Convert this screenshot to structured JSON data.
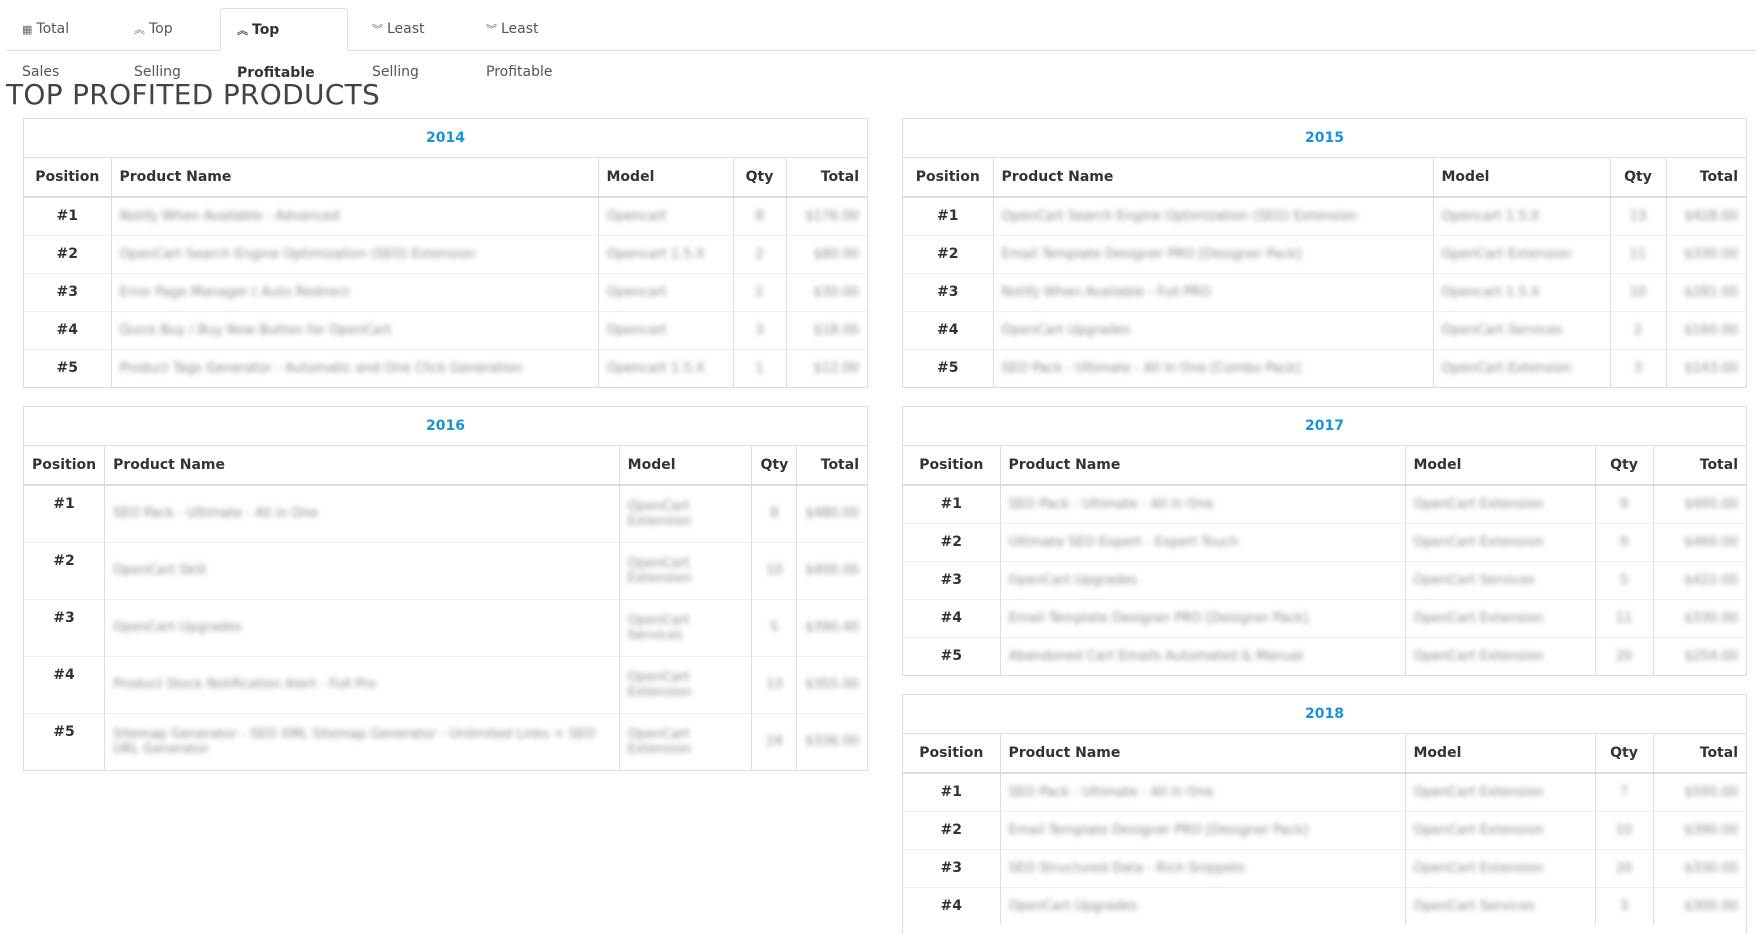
{
  "tabs": [
    {
      "label": "Total Sales",
      "icon": "table-icon",
      "active": false
    },
    {
      "label": "Top Selling",
      "icon": "chevron-double-up-icon",
      "active": false
    },
    {
      "label": "Top Profitable",
      "icon": "chevron-double-up-icon",
      "active": true
    },
    {
      "label": "Least Selling",
      "icon": "chevron-double-down-icon",
      "active": false
    },
    {
      "label": "Least Profitable",
      "icon": "chevron-double-down-icon",
      "active": false
    }
  ],
  "page_title": "TOP PROFITED PRODUCTS",
  "colors": {
    "year_heading": "#1e91cf"
  },
  "columns": {
    "position": "Position",
    "name": "Product Name",
    "model": "Model",
    "qty": "Qty",
    "total": "Total"
  },
  "panels": [
    {
      "year": "2014",
      "rows": [
        {
          "pos": "#1",
          "name": "Notify When Available - Advanced",
          "model": "Opencart",
          "qty": "8",
          "total": "$176.00"
        },
        {
          "pos": "#2",
          "name": "OpenCart Search Engine Optimization (SEO) Extension",
          "model": "Opencart 1.5.X",
          "qty": "2",
          "total": "$80.00"
        },
        {
          "pos": "#3",
          "name": "Error Page Manager ( Auto Redirect",
          "model": "Opencart",
          "qty": "2",
          "total": "$30.00"
        },
        {
          "pos": "#4",
          "name": "Quick Buy / Buy Now Button for OpenCart",
          "model": "Opencart",
          "qty": "3",
          "total": "$18.00"
        },
        {
          "pos": "#5",
          "name": "Product Tags Generator - Automatic and One Click Generation",
          "model": "Opencart 1.5.X",
          "qty": "1",
          "total": "$12.00"
        }
      ]
    },
    {
      "year": "2015",
      "rows": [
        {
          "pos": "#1",
          "name": "OpenCart Search Engine Optimization (SEO) Extension",
          "model": "Opencart 1.5.X",
          "qty": "13",
          "total": "$428.00"
        },
        {
          "pos": "#2",
          "name": "Email Template Designer PRO [Designer Pack]",
          "model": "OpenCart Extension",
          "qty": "11",
          "total": "$330.00"
        },
        {
          "pos": "#3",
          "name": "Notify When Available - Full PRO",
          "model": "Opencart 1.5.X",
          "qty": "10",
          "total": "$281.00"
        },
        {
          "pos": "#4",
          "name": "OpenCart Upgrades",
          "model": "OpenCart Services",
          "qty": "2",
          "total": "$160.00"
        },
        {
          "pos": "#5",
          "name": "SEO Pack - Ultimate - All in One [Combo Pack]",
          "model": "OpenCart Extension",
          "qty": "3",
          "total": "$143.00"
        }
      ]
    },
    {
      "year": "2016",
      "rows": [
        {
          "pos": "#1",
          "name": "SEO Pack - Ultimate - All in One",
          "model": "OpenCart Extension",
          "qty": "8",
          "total": "$480.00"
        },
        {
          "pos": "#2",
          "name": "OpenCart Skill",
          "model": "OpenCart Extension",
          "qty": "10",
          "total": "$400.00"
        },
        {
          "pos": "#3",
          "name": "OpenCart Upgrades",
          "model": "OpenCart Services",
          "qty": "5",
          "total": "$390.40"
        },
        {
          "pos": "#4",
          "name": "Product Stock Notification Alert - Full Pro",
          "model": "OpenCart Extension",
          "qty": "13",
          "total": "$355.00"
        },
        {
          "pos": "#5",
          "name": "Sitemap Generator - SEO XML Sitemap Generator - Unlimited Links + SEO URL Generator",
          "model": "OpenCart Extension",
          "qty": "24",
          "total": "$336.00"
        }
      ]
    },
    {
      "year": "2017",
      "rows": [
        {
          "pos": "#1",
          "name": "SEO Pack - Ultimate - All in One",
          "model": "OpenCart Extension",
          "qty": "9",
          "total": "$495.00"
        },
        {
          "pos": "#2",
          "name": "Ultimate SEO Expert - Expert Touch",
          "model": "OpenCart Extension",
          "qty": "9",
          "total": "$460.00"
        },
        {
          "pos": "#3",
          "name": "OpenCart Upgrades",
          "model": "OpenCart Services",
          "qty": "5",
          "total": "$422.00"
        },
        {
          "pos": "#4",
          "name": "Email Template Designer PRO [Designer Pack]",
          "model": "OpenCart Extension",
          "qty": "11",
          "total": "$330.00"
        },
        {
          "pos": "#5",
          "name": "Abandoned Cart Emails Automated & Manual",
          "model": "OpenCart Extension",
          "qty": "20",
          "total": "$254.00"
        }
      ]
    },
    {
      "year": "2018",
      "rows": [
        {
          "pos": "#1",
          "name": "SEO Pack - Ultimate - All in One",
          "model": "OpenCart Extension",
          "qty": "7",
          "total": "$595.00"
        },
        {
          "pos": "#2",
          "name": "Email Template Designer PRO [Designer Pack]",
          "model": "OpenCart Extension",
          "qty": "10",
          "total": "$390.00"
        },
        {
          "pos": "#3",
          "name": "SEO Structured Data - Rich Snippets",
          "model": "OpenCart Extension",
          "qty": "20",
          "total": "$330.00"
        },
        {
          "pos": "#4",
          "name": "OpenCart Upgrades",
          "model": "OpenCart Services",
          "qty": "3",
          "total": "$300.00"
        }
      ]
    }
  ]
}
